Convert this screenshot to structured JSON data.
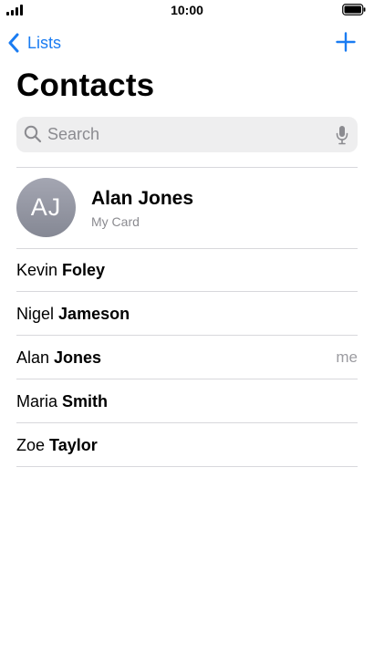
{
  "status_bar": {
    "time": "10:00"
  },
  "nav": {
    "back_label": "Lists"
  },
  "page": {
    "title": "Contacts"
  },
  "search": {
    "placeholder": "Search",
    "value": ""
  },
  "my_card": {
    "initials": "AJ",
    "name": "Alan Jones",
    "subtitle": "My Card"
  },
  "contacts": [
    {
      "first": "Kevin",
      "last": "Foley",
      "tag": ""
    },
    {
      "first": "Nigel",
      "last": "Jameson",
      "tag": ""
    },
    {
      "first": "Alan",
      "last": "Jones",
      "tag": "me"
    },
    {
      "first": "Maria",
      "last": "Smith",
      "tag": ""
    },
    {
      "first": "Zoe",
      "last": "Taylor",
      "tag": ""
    }
  ],
  "colors": {
    "accent": "#1a7cf2",
    "secondary_text": "#8b8b90",
    "search_bg": "#eeeeef",
    "avatar_bg": "#9597a3"
  },
  "icons": {
    "signal": "cellular-signal-icon",
    "battery": "battery-icon",
    "back": "chevron-left-icon",
    "add": "plus-icon",
    "search": "search-icon",
    "mic": "microphone-icon"
  }
}
